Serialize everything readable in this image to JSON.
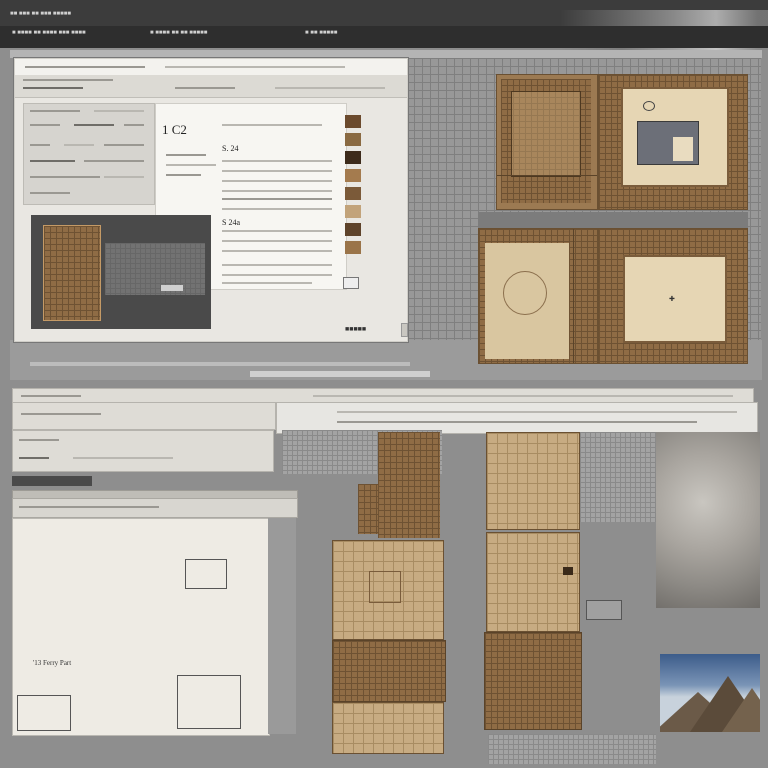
{
  "app": {
    "title_items": [
      "■■ ■■■ ■■ ■■■ ■■■■■"
    ],
    "menu": {
      "left": "■ ■■■■ ■■ ■■■■ ■■■ ■■■■",
      "mid": "■ ■■■■ ■■ ■■ ■■■■■",
      "right": "■ ■■ ■■■■■"
    }
  },
  "doc_window": {
    "page_title": "1 C2",
    "section_a": "S. 24",
    "section_b": "S 24a",
    "footer_label": "■■■■■"
  },
  "lower_left": {
    "map_caption": "'13 Ferry Part"
  },
  "icons": {
    "close": "close-icon",
    "scroll": "scroll-handle-icon"
  },
  "colors": {
    "window_chrome": "#3c3c3c",
    "panel_grey": "#8e8e8e",
    "plan_brown": "#9c7a52",
    "plan_cream": "#e6d6b4",
    "paper": "#f7f6f2"
  }
}
